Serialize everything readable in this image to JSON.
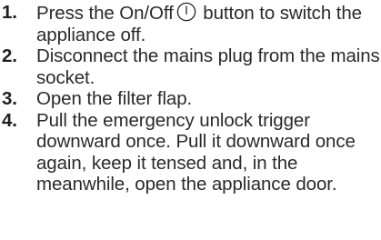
{
  "steps": [
    {
      "number": "1.",
      "text_before_icon": "Press the On/Off",
      "icon": "power-icon",
      "text_after_icon": " button to switch the appliance off."
    },
    {
      "number": "2.",
      "text": "Disconnect the mains plug from the mains socket."
    },
    {
      "number": "3.",
      "text": "Open the filter flap."
    },
    {
      "number": "4.",
      "text": "Pull the emergency unlock trigger downward once. Pull it downward once again, keep it tensed and, in the meanwhile, open the appliance door."
    }
  ],
  "colors": {
    "text": "#2a2a2a",
    "number": "#1f1f1f",
    "background": "#ffffff"
  }
}
